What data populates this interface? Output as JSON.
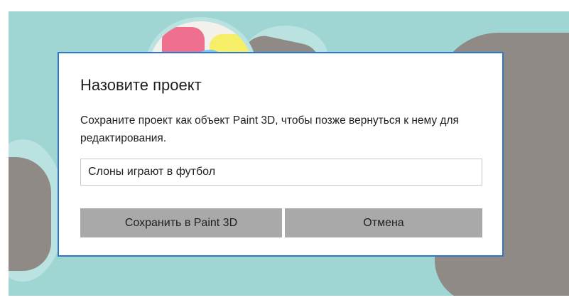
{
  "dialog": {
    "title": "Назовите проект",
    "description": "Сохраните проект как объект Paint 3D, чтобы позже вернуться к нему для редактирования.",
    "input_value": "Слоны играют в футбол",
    "save_label": "Сохранить в Paint 3D",
    "cancel_label": "Отмена"
  },
  "colors": {
    "canvas_background": "#9fd6d3",
    "dialog_border": "#2e77c9",
    "button_background": "#a9a9a9"
  }
}
